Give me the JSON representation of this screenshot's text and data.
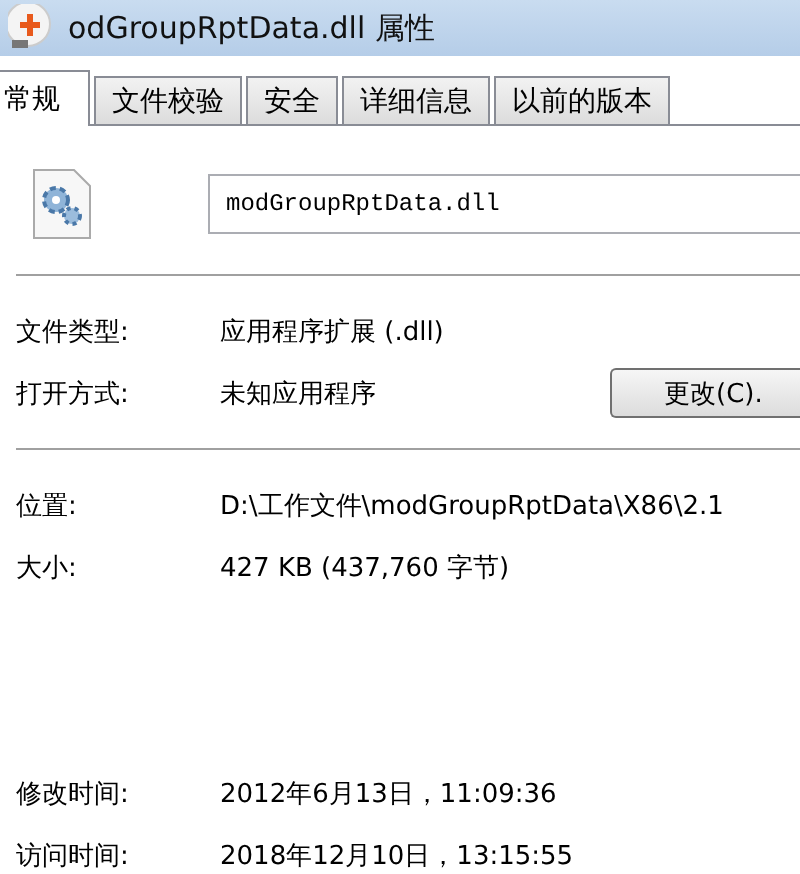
{
  "window": {
    "title": "odGroupRptData.dll 属性"
  },
  "tabs": [
    {
      "label": "常规",
      "selected": true
    },
    {
      "label": "文件校验",
      "selected": false
    },
    {
      "label": "安全",
      "selected": false
    },
    {
      "label": "详细信息",
      "selected": false
    },
    {
      "label": "以前的版本",
      "selected": false
    }
  ],
  "file_name": {
    "value": "modGroupRptData.dll"
  },
  "info_rows": [
    {
      "label": "文件类型:",
      "value": "应用程序扩展 (.dll)"
    },
    {
      "label": "打开方式:",
      "value": "未知应用程序",
      "button": "更改(C)."
    }
  ],
  "location_rows": [
    {
      "label": "位置:",
      "value": "D:\\工作文件\\modGroupRptData\\X86\\2.1"
    },
    {
      "label": "大小:",
      "value": "427 KB (437,760 字节)"
    }
  ],
  "time_rows": [
    {
      "label": "修改时间:",
      "value": "2012年6月13日，11:09:36"
    },
    {
      "label": "访问时间:",
      "value": "2018年12月10日，13:15:55"
    }
  ]
}
